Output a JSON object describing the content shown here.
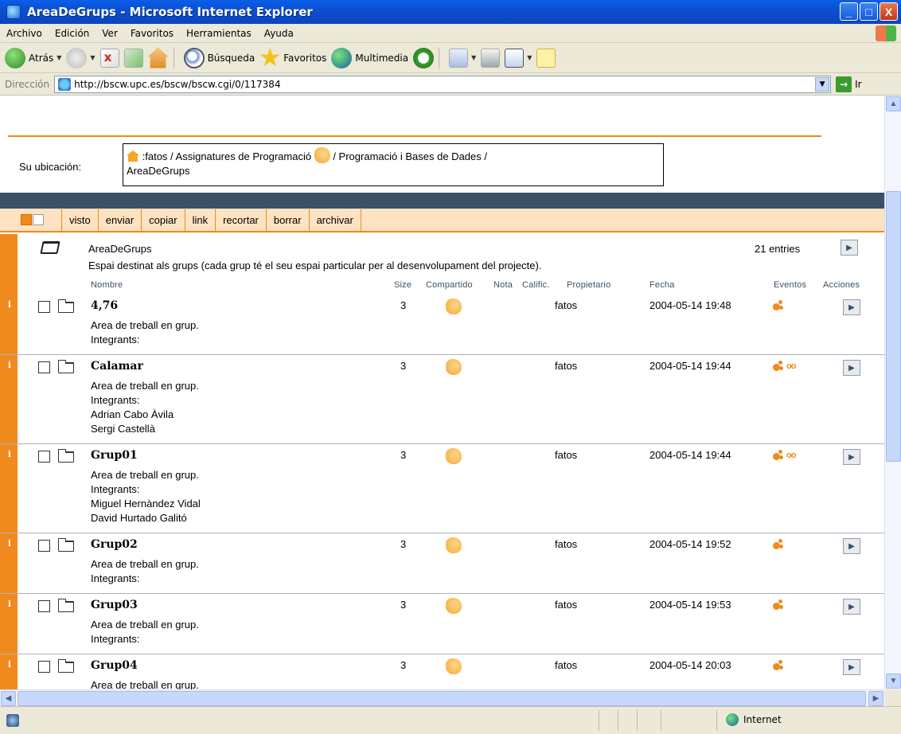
{
  "window": {
    "title": "AreaDeGrups - Microsoft Internet Explorer",
    "buttons": {
      "minimize": "_",
      "maximize": "□",
      "close": "X"
    }
  },
  "menubar": [
    "Archivo",
    "Edición",
    "Ver",
    "Favoritos",
    "Herramientas",
    "Ayuda"
  ],
  "toolbar": {
    "back": "Atrás",
    "search": "Búsqueda",
    "favorites": "Favoritos",
    "media": "Multimedia"
  },
  "address": {
    "label": "Dirección",
    "url": "http://bscw.upc.es/bscw/bscw.cgi/0/117384",
    "go": "Ir"
  },
  "location": {
    "label": "Su ubicación:",
    "path_part1": ":fatos / Assignatures de Programació",
    "path_part2": "/ Programació i Bases de Dades /",
    "path_part3": "AreaDeGrups"
  },
  "actions": [
    "visto",
    "enviar",
    "copiar",
    "link",
    "recortar",
    "borrar",
    "archivar"
  ],
  "folder": {
    "name": "AreaDeGrups",
    "description": "Espai destinat als grups (cada grup té el seu espai particular per al desenvolupament del projecte).",
    "entries": "21 entries"
  },
  "columns": {
    "name": "Nombre",
    "size": "Size",
    "shared": "Compartido",
    "note": "Nota",
    "rating": "Calific.",
    "owner": "Propietario",
    "date": "Fecha",
    "events": "Eventos",
    "actions": "Acciones"
  },
  "rows": [
    {
      "name": "4,76",
      "lines": [
        "Area de treball en grup.",
        "Integrants:"
      ],
      "size": "3",
      "owner": "fatos",
      "date": "2004-05-14 19:48",
      "read_icon": false
    },
    {
      "name": "Calamar",
      "lines": [
        "Area de treball en grup.",
        "Integrants:",
        "Adrian Cabo Àvila",
        "Sergi Castellà"
      ],
      "size": "3",
      "owner": "fatos",
      "date": "2004-05-14 19:44",
      "read_icon": true
    },
    {
      "name": "Grup01",
      "lines": [
        "Area de treball en grup.",
        "Integrants:",
        "Miguel Hernàndez Vidal",
        "David Hurtado Galitó"
      ],
      "size": "3",
      "owner": "fatos",
      "date": "2004-05-14 19:44",
      "read_icon": true
    },
    {
      "name": "Grup02",
      "lines": [
        "Area de treball en grup.",
        "Integrants:"
      ],
      "size": "3",
      "owner": "fatos",
      "date": "2004-05-14 19:52",
      "read_icon": false
    },
    {
      "name": "Grup03",
      "lines": [
        "Area de treball en grup.",
        "Integrants:"
      ],
      "size": "3",
      "owner": "fatos",
      "date": "2004-05-14 19:53",
      "read_icon": false
    },
    {
      "name": "Grup04",
      "lines": [
        "Area de treball en grup."
      ],
      "size": "3",
      "owner": "fatos",
      "date": "2004-05-14 20:03",
      "read_icon": false
    }
  ],
  "status": {
    "zone": "Internet"
  },
  "colors": {
    "accent": "#f08a1e",
    "dark_bar": "#3c5066",
    "action_bg": "#fde3c1",
    "titlebar": "#0b4fd0"
  }
}
